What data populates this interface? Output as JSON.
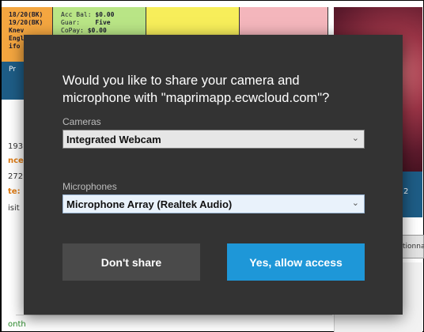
{
  "background": {
    "orange_tile_lines": [
      "18/20(BK)",
      "19/20(BK)",
      "Knev",
      "Engli",
      "ifo"
    ],
    "orange_tile_button": "Pr",
    "green_tile": {
      "rows": [
        {
          "label": "Acc Bal:",
          "value": "$0.00"
        },
        {
          "label": "Guar:",
          "value": "Five"
        },
        {
          "label": "CoPay:",
          "value": "$0.00"
        }
      ]
    },
    "left_texts": [
      "193",
      "nce",
      "272",
      "te:",
      "isit",
      "onth"
    ],
    "right_tile_text": "2",
    "right_button_text": "tionna"
  },
  "dialog": {
    "title": "Would you like to share your camera and microphone with \"maprimapp.ecwcloud.com\"?",
    "cameras_label": "Cameras",
    "camera_value": "Integrated Webcam",
    "microphones_label": "Microphones",
    "microphone_value": "Microphone Array (Realtek Audio)",
    "deny_button": "Don't share",
    "allow_button": "Yes, allow access"
  },
  "colors": {
    "dialog_bg": "#333333",
    "allow_button": "#1e97d8",
    "deny_button": "#4a4a4a"
  },
  "icons": {
    "dropdown": "chevron-down-icon"
  }
}
